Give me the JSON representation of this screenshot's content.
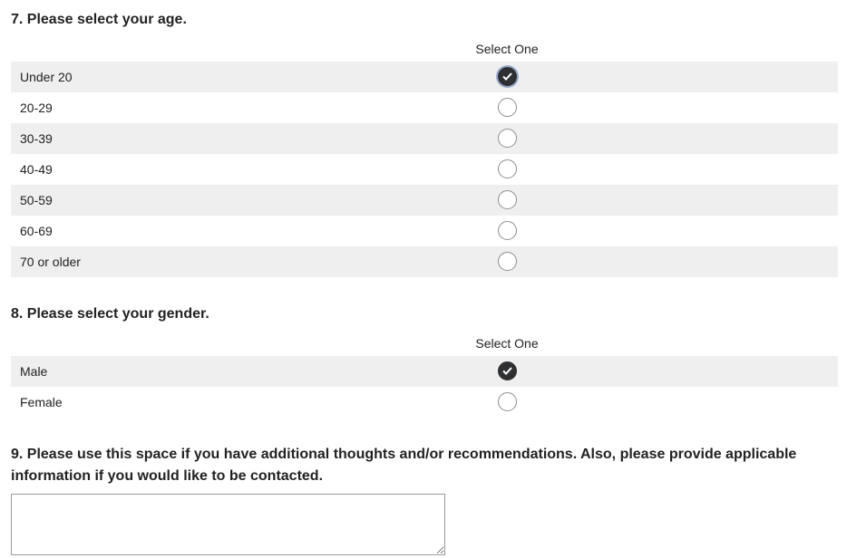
{
  "q7": {
    "title": "7. Please select your age.",
    "column_header": "Select One",
    "options": [
      {
        "label": "Under 20",
        "checked": true
      },
      {
        "label": "20-29",
        "checked": false
      },
      {
        "label": "30-39",
        "checked": false
      },
      {
        "label": "40-49",
        "checked": false
      },
      {
        "label": "50-59",
        "checked": false
      },
      {
        "label": "60-69",
        "checked": false
      },
      {
        "label": "70 or older",
        "checked": false
      }
    ]
  },
  "q8": {
    "title": "8. Please select your gender.",
    "column_header": "Select One",
    "options": [
      {
        "label": "Male",
        "checked": true
      },
      {
        "label": "Female",
        "checked": false
      }
    ]
  },
  "q9": {
    "title": "9. Please use this space if you have additional thoughts and/or recommendations. Also, please provide applicable information if you would like to be contacted.",
    "value": ""
  },
  "colors": {
    "row_shade": "#efefef",
    "radio_checked": "#2f3032",
    "radio_border": "#8e8e8e"
  }
}
